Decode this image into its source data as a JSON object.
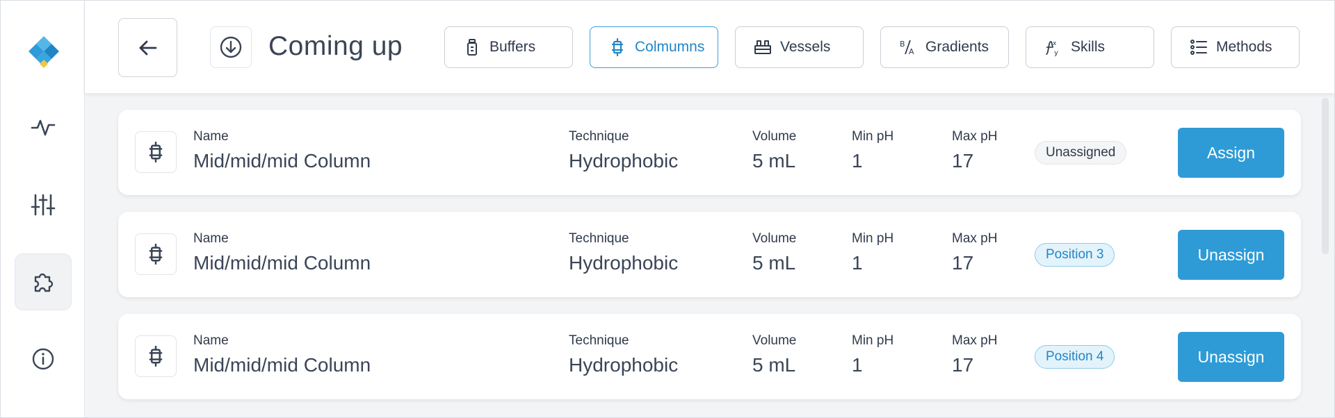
{
  "header": {
    "title": "Coming up",
    "tabs": [
      {
        "label": "Buffers",
        "active": false
      },
      {
        "label": "Colmumns",
        "active": true
      },
      {
        "label": "Vessels",
        "active": false
      },
      {
        "label": "Gradients",
        "active": false
      },
      {
        "label": "Skills",
        "active": false
      },
      {
        "label": "Methods",
        "active": false
      }
    ]
  },
  "sidebar": {
    "items": [
      {
        "icon": "activity-icon",
        "active": false
      },
      {
        "icon": "sliders-icon",
        "active": false
      },
      {
        "icon": "puzzle-icon",
        "active": true
      },
      {
        "icon": "info-icon",
        "active": false
      }
    ]
  },
  "labels": {
    "name": "Name",
    "technique": "Technique",
    "volume": "Volume",
    "min_ph": "Min pH",
    "max_ph": "Max pH"
  },
  "columns": [
    {
      "name": "Mid/mid/mid Column",
      "technique": "Hydrophobic",
      "volume": "5 mL",
      "min_ph": "1",
      "max_ph": "17",
      "status": "Unassigned",
      "status_type": "unassigned",
      "action": "Assign"
    },
    {
      "name": "Mid/mid/mid Column",
      "technique": "Hydrophobic",
      "volume": "5 mL",
      "min_ph": "1",
      "max_ph": "17",
      "status": "Position 3",
      "status_type": "position",
      "action": "Unassign"
    },
    {
      "name": "Mid/mid/mid Column",
      "technique": "Hydrophobic",
      "volume": "5 mL",
      "min_ph": "1",
      "max_ph": "17",
      "status": "Position 4",
      "status_type": "position",
      "action": "Unassign"
    }
  ],
  "colors": {
    "accent": "#2e9bd6",
    "accent_text": "#2386c5",
    "logo_blue": "#2d9bd8",
    "logo_yellow": "#f4c542"
  }
}
